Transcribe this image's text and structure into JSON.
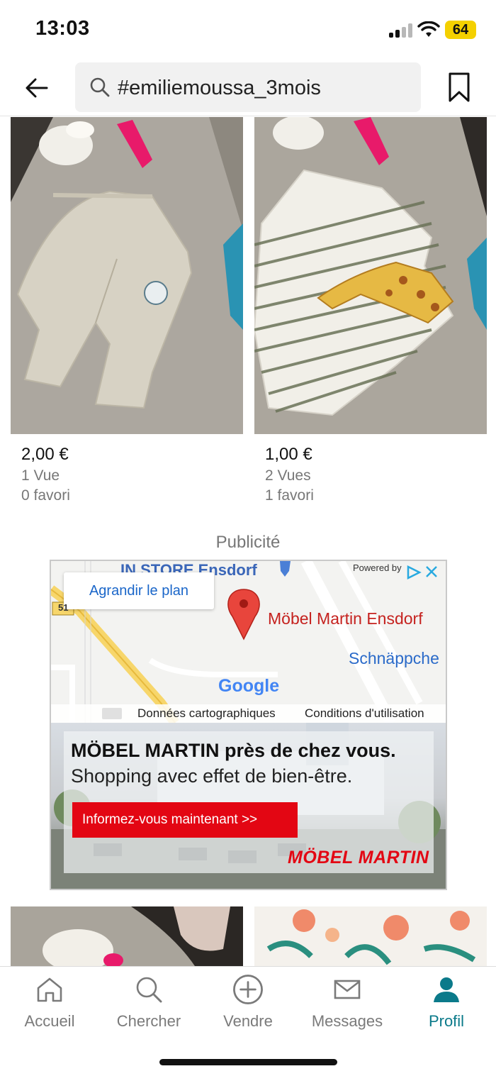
{
  "status": {
    "time": "13:03",
    "battery": "64"
  },
  "header": {
    "search_query": "#emiliemoussa_3mois"
  },
  "products": [
    {
      "price": "2,00 €",
      "views": "1 Vue",
      "favorites": "0 favori"
    },
    {
      "price": "1,00 €",
      "views": "2 Vues",
      "favorites": "1 favori"
    }
  ],
  "ad": {
    "label": "Publicité",
    "map_enlarge": "Agrandir le plan",
    "map_store_label": "IN STORE Ensdorf",
    "map_store_name": "Möbel Martin Ensdorf",
    "map_poi": "Schnäppche",
    "map_road": "51",
    "powered_by": "Powered by",
    "map_brand": "Google",
    "map_data": "Données cartographiques",
    "map_terms": "Conditions d'utilisation",
    "headline_bold": "MÖBEL MARTIN",
    "headline_rest": " près de chez vous.",
    "subline": "Shopping avec effet de bien-être.",
    "cta": "Informez-vous maintenant  >>",
    "logo": "MÖBEL MARTIN"
  },
  "nav": {
    "items": [
      {
        "label": "Accueil",
        "icon": "home-icon"
      },
      {
        "label": "Chercher",
        "icon": "search-icon"
      },
      {
        "label": "Vendre",
        "icon": "plus-circle-icon"
      },
      {
        "label": "Messages",
        "icon": "mail-icon"
      },
      {
        "label": "Profil",
        "icon": "profile-icon"
      }
    ],
    "active_color": "#0b7a8a",
    "inactive_color": "#7a7a7a"
  }
}
